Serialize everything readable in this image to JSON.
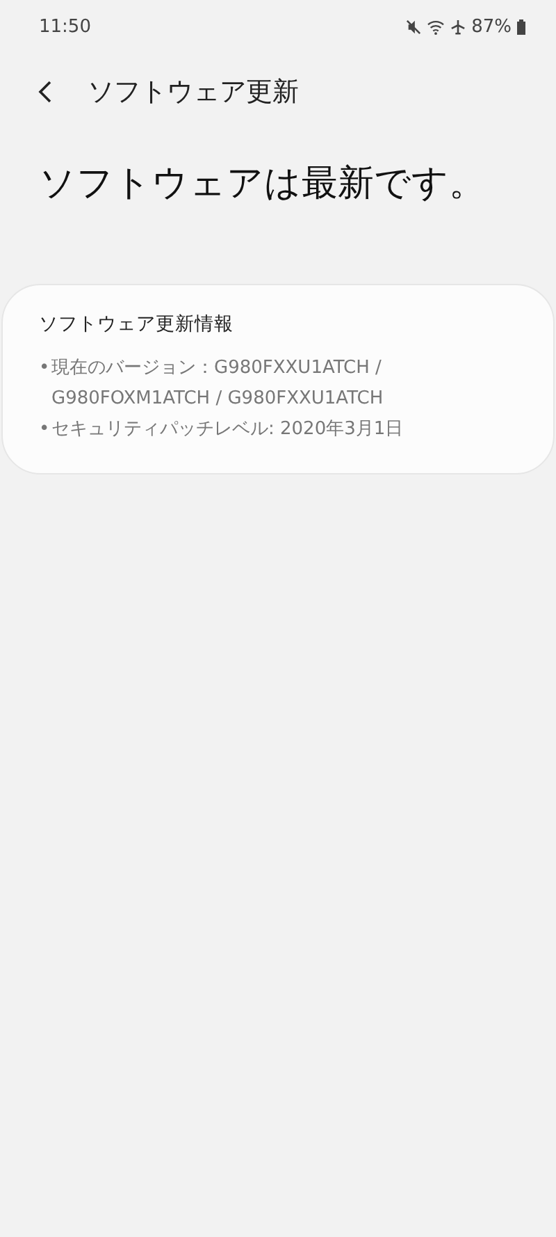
{
  "status_bar": {
    "time": "11:50",
    "battery": "87%"
  },
  "header": {
    "title": "ソフトウェア更新"
  },
  "headline": "ソフトウェアは最新です。",
  "info_card": {
    "title": "ソフトウェア更新情報",
    "items": [
      {
        "bullet": "•",
        "text": "現在のバージョン：G980FXXU1ATCH / G980FOXM1ATCH / G980FXXU1ATCH"
      },
      {
        "bullet": "•",
        "text": "セキュリティパッチレベル: 2020年3月1日"
      }
    ]
  }
}
